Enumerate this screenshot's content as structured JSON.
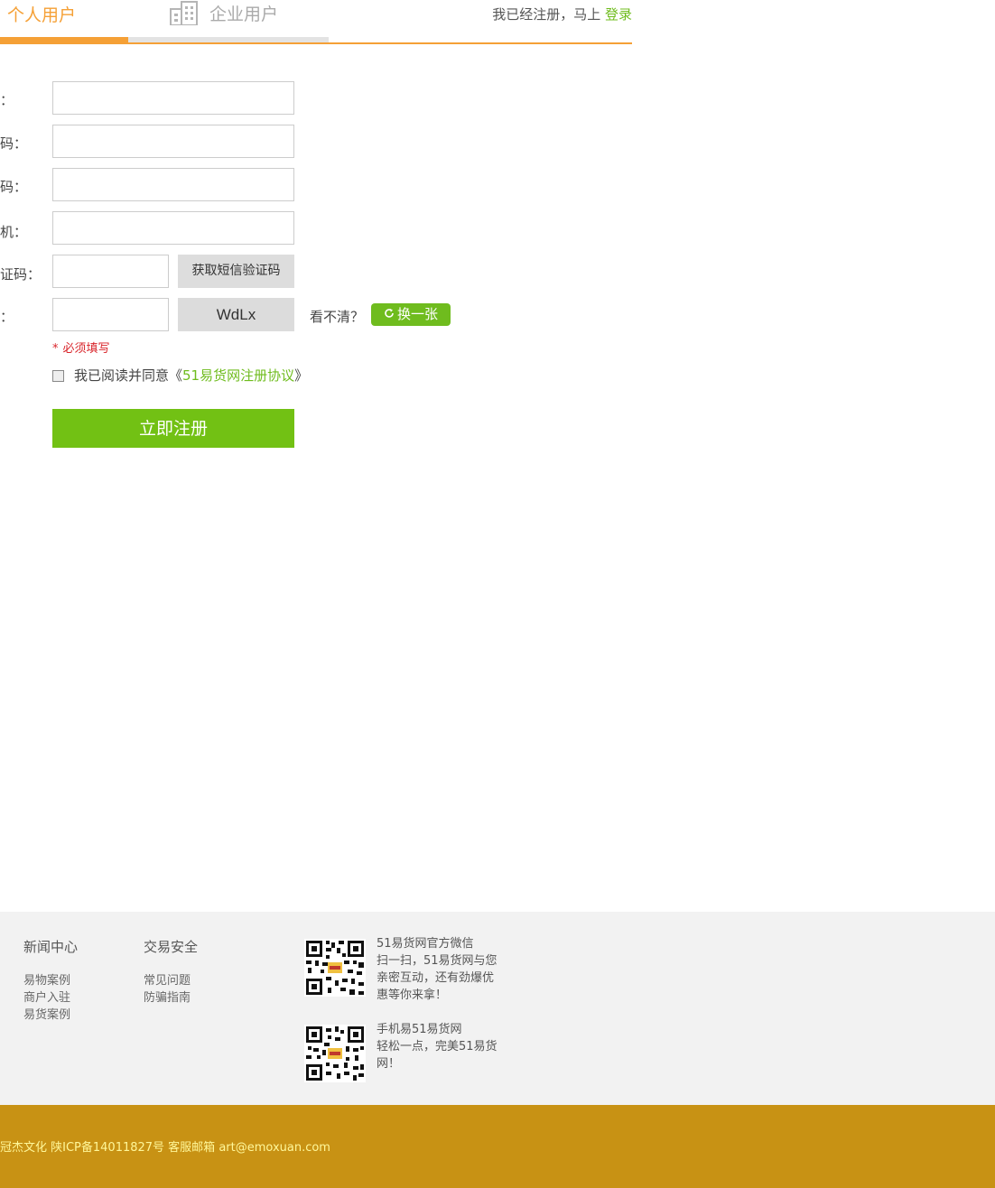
{
  "tabs": {
    "personal": "个人用户",
    "company": "企业用户"
  },
  "login_hint": {
    "text": "我已经注册，马上",
    "link": "登录"
  },
  "form": {
    "labels": {
      "username": "：",
      "password": "码：",
      "confirm_password": "码：",
      "phone": "机：",
      "sms_code": "证码：",
      "captcha": "："
    },
    "sms_button": "获取短信验证码",
    "captcha_text": "WdLx",
    "cant_see": "看不清？",
    "refresh_button": "换一张",
    "required_star": "*",
    "required_note": "必须填写",
    "agree_prefix": "我已阅读并同意《",
    "agree_link": "51易货网注册协议",
    "agree_suffix": "》",
    "submit": "立即注册"
  },
  "footer": {
    "col1": {
      "title": "新闻中心",
      "links": [
        "易物案例",
        "商户入驻",
        "易货案例"
      ]
    },
    "col2": {
      "title": "交易安全",
      "links": [
        "常见问题",
        "防骗指南"
      ]
    },
    "wechat": {
      "line1": "51易货网官方微信",
      "line2": "扫一扫，51易货网与您亲密互动，还有劲爆优惠等你来拿！"
    },
    "mobile": {
      "line1": "手机易51易货网",
      "line2": "轻松一点，完美51易货网！"
    },
    "copyright": "冠杰文化 陕ICP备14011827号 客服邮箱 art@emoxuan.com"
  },
  "colors": {
    "accent_orange": "#f5a036",
    "accent_green": "#6fbc1e",
    "footer_bar": "#c89214",
    "required_red": "#d9252b"
  },
  "icons": [
    "building-icon",
    "refresh-icon",
    "qr-code-wechat",
    "qr-code-mobile"
  ]
}
